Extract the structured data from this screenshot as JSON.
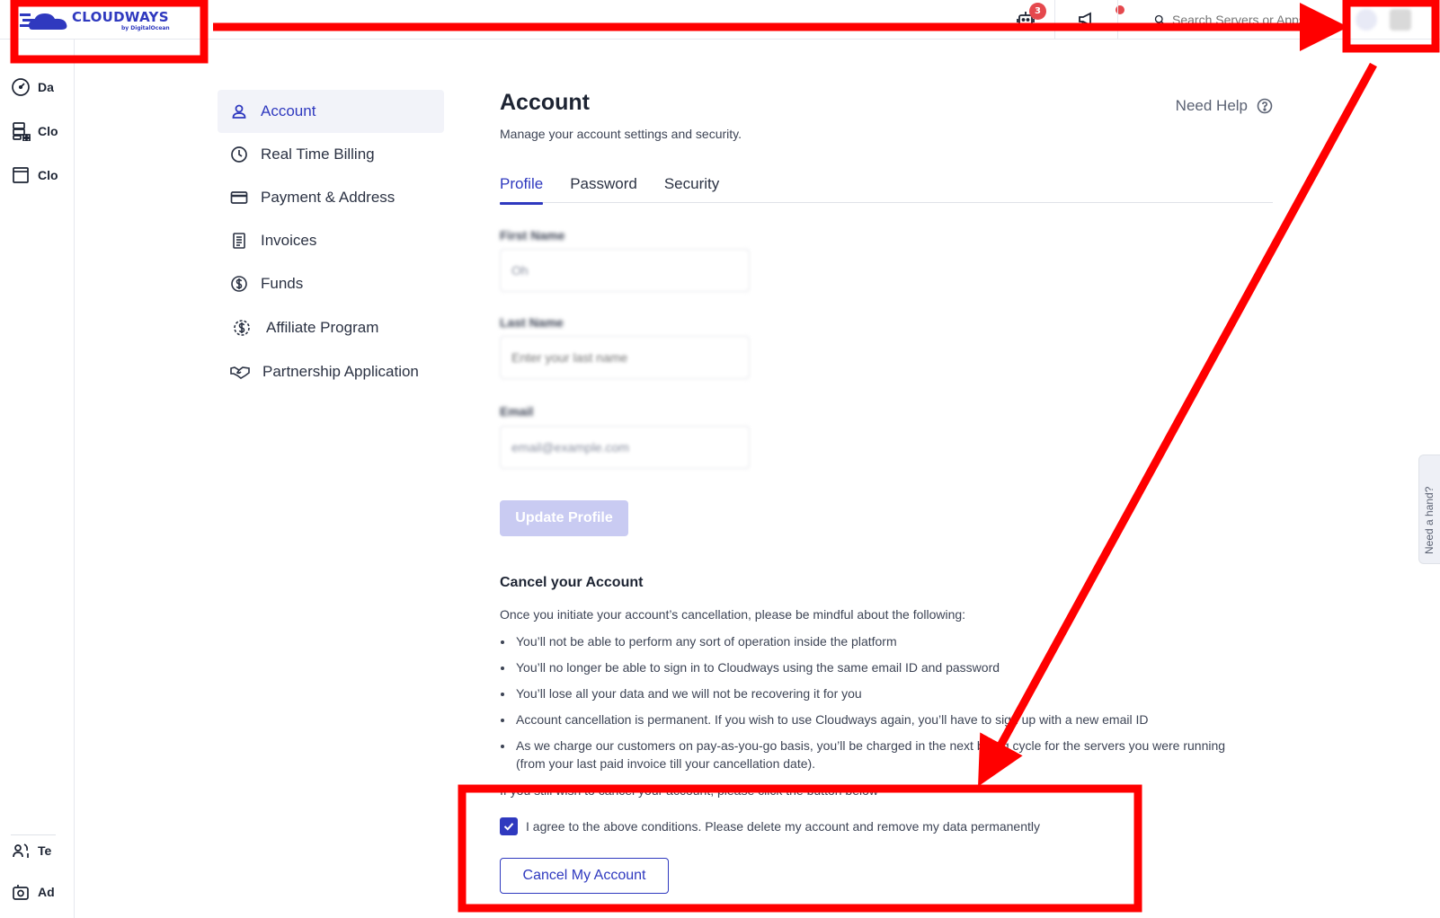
{
  "brand": {
    "name": "CLOUDWAYS",
    "sub": "by DigitalOcean",
    "color": "#2f39bf"
  },
  "topbar": {
    "bot_badge": "3",
    "search_placeholder": "Search Servers or Apps",
    "icons": [
      "robot-icon",
      "megaphone-icon",
      "search-icon"
    ]
  },
  "rail": {
    "items": [
      {
        "label": "Da",
        "icon": "dashboard-icon"
      },
      {
        "label": "Clo",
        "icon": "servers-icon"
      },
      {
        "label": "Clo",
        "icon": "apps-window-icon"
      },
      {
        "label": "Te",
        "icon": "team-icon"
      },
      {
        "label": "Ad",
        "icon": "addons-icon"
      }
    ]
  },
  "subnav": {
    "items": [
      {
        "label": "Account",
        "icon": "user-icon",
        "active": true
      },
      {
        "label": "Real Time Billing",
        "icon": "clock-icon"
      },
      {
        "label": "Payment & Address",
        "icon": "credit-card-icon"
      },
      {
        "label": "Invoices",
        "icon": "invoice-icon"
      },
      {
        "label": "Funds",
        "icon": "dollar-icon"
      },
      {
        "label": "Affiliate Program",
        "icon": "affiliate-icon"
      },
      {
        "label": "Partnership Application",
        "icon": "handshake-icon"
      }
    ]
  },
  "page": {
    "title": "Account",
    "subtitle": "Manage your account settings and security.",
    "need_help": "Need Help",
    "tabs": [
      {
        "label": "Profile",
        "active": true
      },
      {
        "label": "Password"
      },
      {
        "label": "Security"
      }
    ]
  },
  "profile": {
    "first_name_label": "First Name",
    "first_name_value": "Oh",
    "last_name_label": "Last Name",
    "last_name_placeholder": "Enter your last name",
    "email_label": "Email",
    "email_value": "email@example.com",
    "update_label": "Update Profile"
  },
  "cancel": {
    "title": "Cancel your Account",
    "intro": "Once you initiate your account’s cancellation, please be mindful about the following:",
    "bullets": [
      "You’ll not be able to perform any sort of operation inside the platform",
      "You’ll no longer be able to sign in to Cloudways using the same email ID and password",
      "You’ll lose all your data and we will not be recovering it for you",
      "Account cancellation is permanent. If you wish to use Cloudways again, you’ll have to sign up with a new email ID",
      "As we charge our customers on pay-as-you-go basis, you’ll be charged in the next billing cycle for the servers you were running (from your last paid invoice till your cancellation date)."
    ],
    "note": "If you still wish to cancel your account, please click the button below",
    "agree_text": "I agree to the above conditions. Please delete my account and remove my data permanently",
    "agree_checked": true,
    "button_label": "Cancel My Account"
  },
  "help_tab": {
    "label": "Need a hand?"
  },
  "annotation": {
    "color": "#ff0000"
  }
}
